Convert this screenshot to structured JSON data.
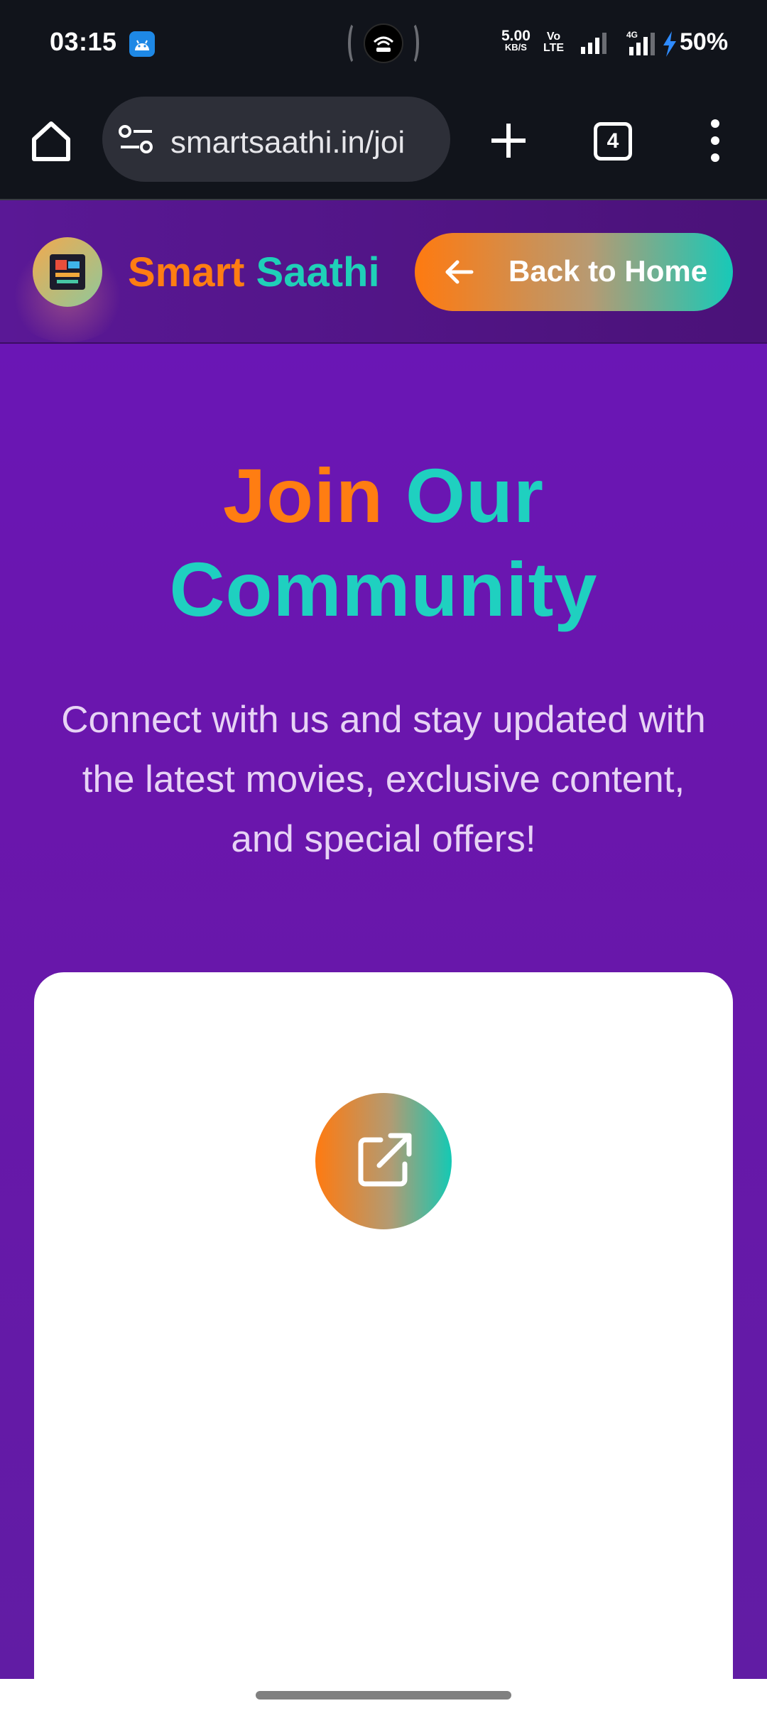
{
  "status_bar": {
    "time": "03:15",
    "net_speed_value": "5.00",
    "net_speed_unit": "KB/S",
    "volte_top": "Vo",
    "volte_bottom": "LTE",
    "network_type": "4G",
    "battery": "50%"
  },
  "browser": {
    "url": "smartsaathi.in/joi",
    "tab_count": "4"
  },
  "header": {
    "brand_part1": "Smart",
    "brand_part2": "Saathi",
    "back_button_label": "Back to Home"
  },
  "hero": {
    "title_part1": "Join",
    "title_part2": "Our",
    "title_line2": "Community",
    "subtitle": "Connect with us and stay updated with the latest movies, exclusive content, and special offers!"
  },
  "card": {
    "icon": "external-link-icon"
  },
  "colors": {
    "accent_orange": "#ff7d12",
    "accent_teal": "#1fd0c0",
    "page_purple": "#6a16b8"
  }
}
